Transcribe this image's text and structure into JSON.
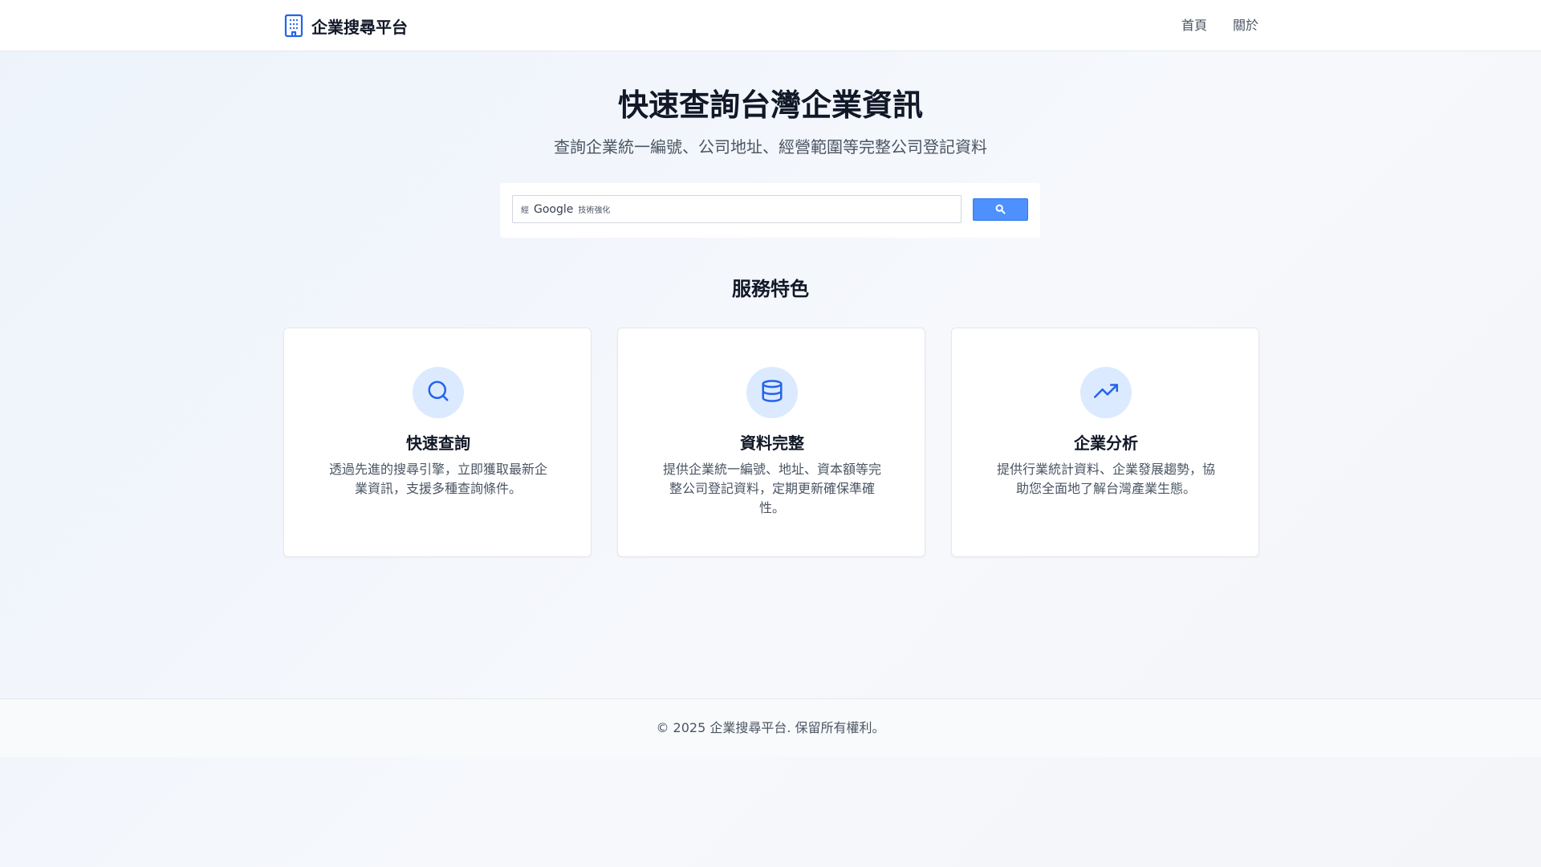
{
  "header": {
    "brand_icon": "building-icon",
    "brand_name": "企業搜尋平台",
    "nav": [
      {
        "label": "首頁"
      },
      {
        "label": "關於"
      }
    ]
  },
  "hero": {
    "title": "快速查詢台灣企業資訊",
    "subtitle": "查詢企業統一編號、公司地址、經營範圍等完整公司登記資料"
  },
  "search": {
    "prefix": "經",
    "brand": "Google",
    "suffix": "技術強化",
    "button_icon": "search-icon",
    "accent_color": "#4d90fe"
  },
  "features": {
    "title": "服務特色",
    "cards": [
      {
        "icon": "search-icon",
        "title": "快速查詢",
        "description": "透過先進的搜尋引擎，立即獲取最新企業資訊，支援多種查詢條件。"
      },
      {
        "icon": "database-icon",
        "title": "資料完整",
        "description": "提供企業統一編號、地址、資本額等完整公司登記資料，定期更新確保準確性。"
      },
      {
        "icon": "trending-up-icon",
        "title": "企業分析",
        "description": "提供行業統計資料、企業發展趨勢，協助您全面地了解台灣產業生態。"
      }
    ]
  },
  "footer": {
    "copyright": "© 2025 企業搜尋平台. 保留所有權利。"
  },
  "colors": {
    "primary": "#2563eb",
    "icon_bg": "#dbeafe"
  }
}
